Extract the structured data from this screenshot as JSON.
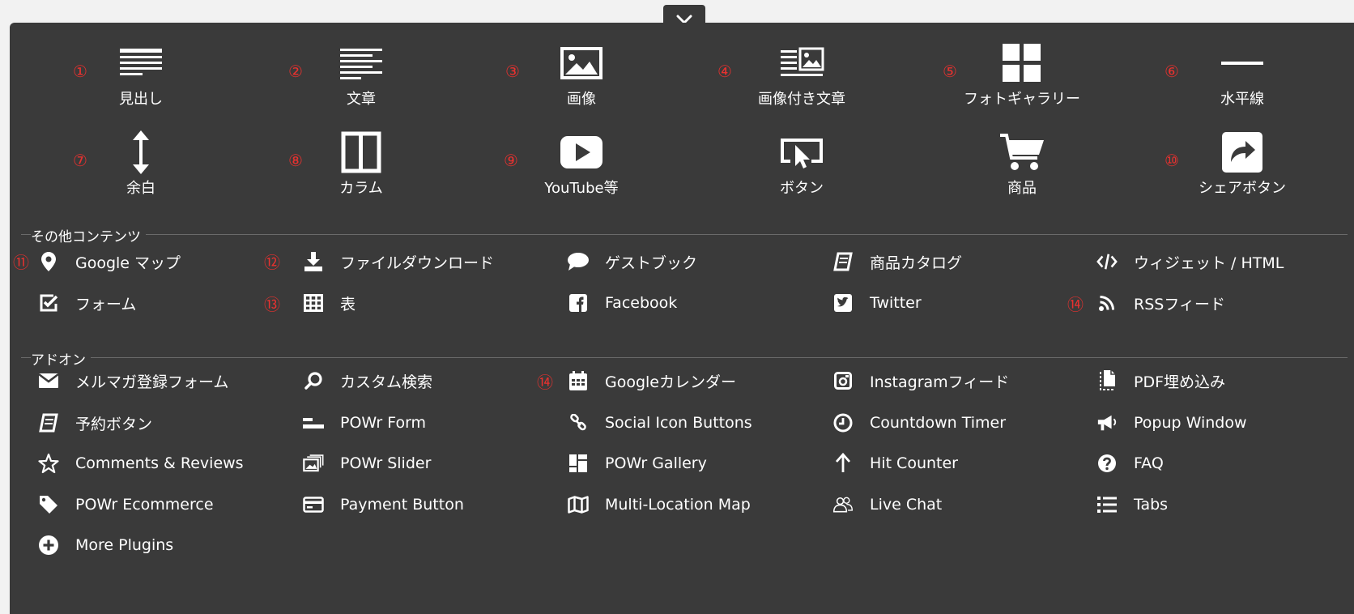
{
  "close_label": "close",
  "blocks": [
    {
      "label": "見出し",
      "num": "①",
      "icon": "heading-icon"
    },
    {
      "label": "文章",
      "num": "②",
      "icon": "text-icon"
    },
    {
      "label": "画像",
      "num": "③",
      "icon": "image-icon"
    },
    {
      "label": "画像付き文章",
      "num": "④",
      "icon": "image-text-icon"
    },
    {
      "label": "フォトギャラリー",
      "num": "⑤",
      "icon": "gallery-icon"
    },
    {
      "label": "水平線",
      "num": "⑥",
      "icon": "horizontal-line-icon"
    },
    {
      "label": "余白",
      "num": "⑦",
      "icon": "spacer-icon"
    },
    {
      "label": "カラム",
      "num": "⑧",
      "icon": "columns-icon"
    },
    {
      "label": "YouTube等",
      "num": "⑨",
      "icon": "video-play-icon"
    },
    {
      "label": "ボタン",
      "num": "",
      "icon": "button-cursor-icon"
    },
    {
      "label": "商品",
      "num": "",
      "icon": "cart-icon"
    },
    {
      "label": "シェアボタン",
      "num": "⑩",
      "icon": "share-icon"
    }
  ],
  "sections": {
    "other": "その他コンテンツ",
    "addon": "アドオン"
  },
  "other_items": [
    {
      "label": "Google マップ",
      "num": "⑪",
      "icon": "map-pin-icon"
    },
    {
      "label": "ファイルダウンロード",
      "num": "⑫",
      "icon": "download-icon"
    },
    {
      "label": "ゲストブック",
      "num": "",
      "icon": "speech-bubble-icon"
    },
    {
      "label": "商品カタログ",
      "num": "",
      "icon": "catalog-book-icon"
    },
    {
      "label": "ウィジェット / HTML",
      "num": "",
      "icon": "code-icon"
    },
    {
      "label": "フォーム",
      "num": "",
      "icon": "checkbox-icon"
    },
    {
      "label": "表",
      "num": "⑬",
      "icon": "table-icon"
    },
    {
      "label": "Facebook",
      "num": "",
      "icon": "facebook-icon"
    },
    {
      "label": "Twitter",
      "num": "",
      "icon": "twitter-icon"
    },
    {
      "label": "RSSフィード",
      "num": "⑭",
      "icon": "rss-icon"
    }
  ],
  "addon_items": [
    {
      "label": "メルマガ登録フォーム",
      "num": "",
      "icon": "envelope-icon"
    },
    {
      "label": "カスタム検索",
      "num": "",
      "icon": "search-icon"
    },
    {
      "label": "Googleカレンダー",
      "num": "⑭",
      "icon": "calendar-icon"
    },
    {
      "label": "Instagramフィード",
      "num": "",
      "icon": "instagram-icon"
    },
    {
      "label": "PDF埋め込み",
      "num": "",
      "icon": "pdf-file-icon"
    },
    {
      "label": "予約ボタン",
      "num": "",
      "icon": "booking-book-icon"
    },
    {
      "label": "POWr Form",
      "num": "",
      "icon": "form-lines-icon"
    },
    {
      "label": "Social Icon Buttons",
      "num": "",
      "icon": "link-chain-icon"
    },
    {
      "label": "Countdown Timer",
      "num": "",
      "icon": "clock-icon"
    },
    {
      "label": "Popup Window",
      "num": "",
      "icon": "megaphone-icon"
    },
    {
      "label": "Comments & Reviews",
      "num": "",
      "icon": "star-icon"
    },
    {
      "label": "POWr Slider",
      "num": "",
      "icon": "slider-images-icon"
    },
    {
      "label": "POWr Gallery",
      "num": "",
      "icon": "gallery-grid-icon"
    },
    {
      "label": "Hit Counter",
      "num": "",
      "icon": "arrow-up-icon"
    },
    {
      "label": "FAQ",
      "num": "",
      "icon": "question-circle-icon"
    },
    {
      "label": "POWr Ecommerce",
      "num": "",
      "icon": "tag-icon"
    },
    {
      "label": "Payment Button",
      "num": "",
      "icon": "credit-card-icon"
    },
    {
      "label": "Multi-Location Map",
      "num": "",
      "icon": "folded-map-icon"
    },
    {
      "label": "Live Chat",
      "num": "",
      "icon": "users-chat-icon"
    },
    {
      "label": "Tabs",
      "num": "",
      "icon": "list-icon"
    },
    {
      "label": "More Plugins",
      "num": "",
      "icon": "plus-circle-icon"
    }
  ]
}
